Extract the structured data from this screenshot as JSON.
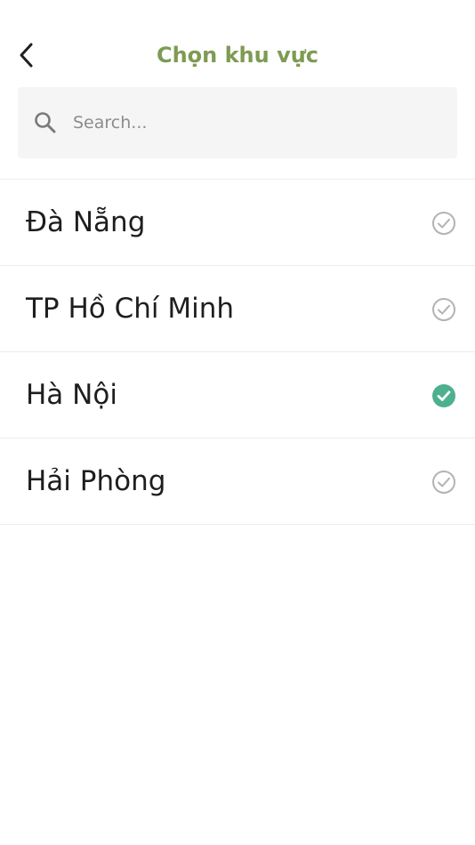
{
  "header": {
    "title": "Chọn khu vực",
    "back_icon": "chevron-left-icon"
  },
  "search": {
    "placeholder": "Search...",
    "value": "",
    "icon": "search-icon"
  },
  "regions": [
    {
      "name": "Đà Nẵng",
      "selected": false
    },
    {
      "name": "TP Hồ Chí Minh",
      "selected": false
    },
    {
      "name": "Hà Nội",
      "selected": true
    },
    {
      "name": "Hải Phòng",
      "selected": false
    }
  ],
  "colors": {
    "title": "#7e9b52",
    "selected_check": "#4db08e",
    "unselected_check": "#b3b3b3",
    "search_background": "#f5f5f5",
    "divider": "#ececec"
  }
}
